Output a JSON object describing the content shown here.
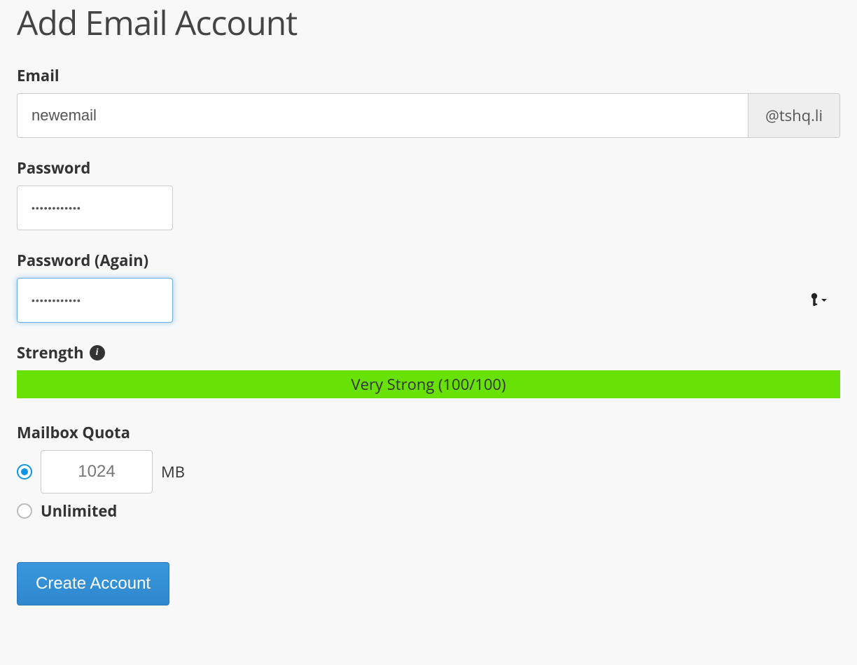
{
  "page": {
    "title": "Add Email Account"
  },
  "email": {
    "label": "Email",
    "value": "newemail",
    "domain_addon": "@tshq.li"
  },
  "password": {
    "label": "Password",
    "value": "••••••••••••"
  },
  "password_again": {
    "label": "Password (Again)",
    "value": "••••••••••••"
  },
  "strength": {
    "label": "Strength",
    "text": "Very Strong (100/100)"
  },
  "quota": {
    "label": "Mailbox Quota",
    "value": "1024",
    "unit": "MB",
    "unlimited_label": "Unlimited"
  },
  "actions": {
    "create": "Create Account"
  }
}
